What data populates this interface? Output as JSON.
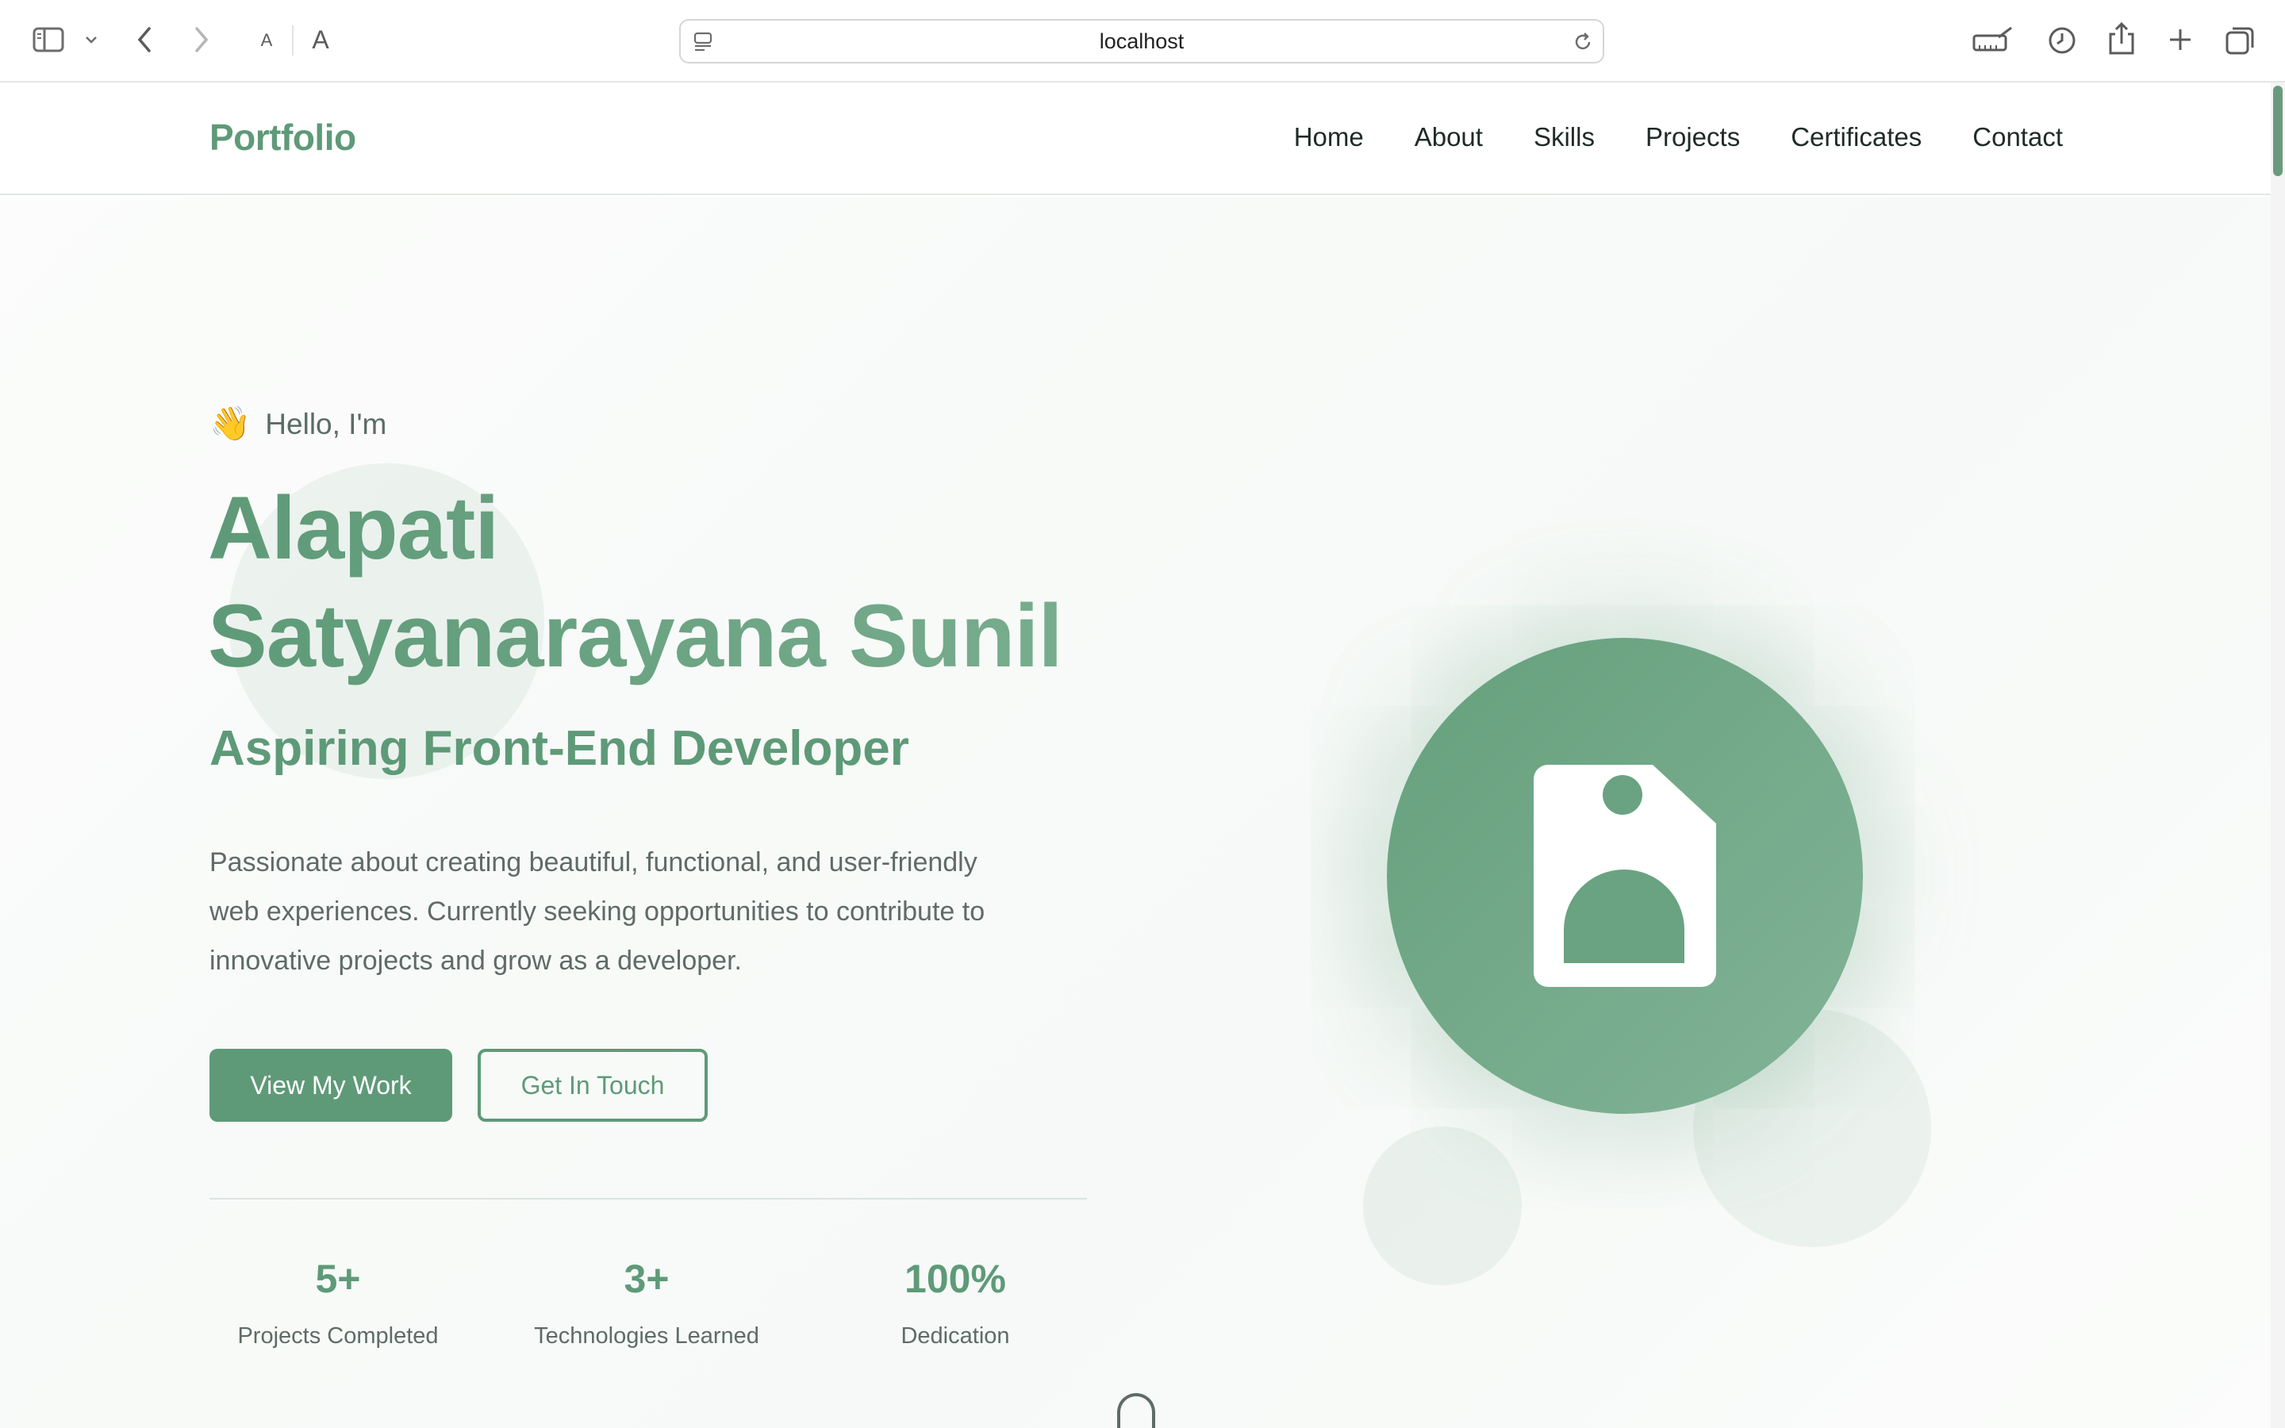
{
  "browser": {
    "url": "localhost",
    "icons": [
      "sidebar-icon",
      "chevron-down-icon",
      "back-icon",
      "forward-icon",
      "text-smaller-icon",
      "text-larger-icon",
      "page-icon",
      "reload-icon",
      "ruler-pen-icon",
      "history-clock-icon",
      "share-icon",
      "plus-icon",
      "tabs-icon"
    ],
    "text_small": "A",
    "text_large": "A"
  },
  "nav": {
    "brand": "Portfolio",
    "links": [
      "Home",
      "About",
      "Skills",
      "Projects",
      "Certificates",
      "Contact"
    ]
  },
  "hero": {
    "greeting_emoji": "👋",
    "greeting": "Hello, I'm",
    "name_line1": "Alapati",
    "name_line2": "Satyanarayana Sunil",
    "role": "Aspiring Front-End Developer",
    "description": "Passionate about creating beautiful, functional, and user-friendly web experiences. Currently seeking opportunities to contribute to innovative projects and grow as a developer.",
    "primary_button": "View My Work",
    "secondary_button": "Get In Touch",
    "stats": [
      {
        "value": "5+",
        "label": "Projects Completed"
      },
      {
        "value": "3+",
        "label": "Technologies Learned"
      },
      {
        "value": "100%",
        "label": "Dedication"
      }
    ],
    "avatar_icon": "id-badge-icon"
  },
  "colors": {
    "accent": "#5e9a78",
    "accent_light": "#83b398",
    "text": "#1f2b27",
    "muted": "#5f6b67"
  }
}
